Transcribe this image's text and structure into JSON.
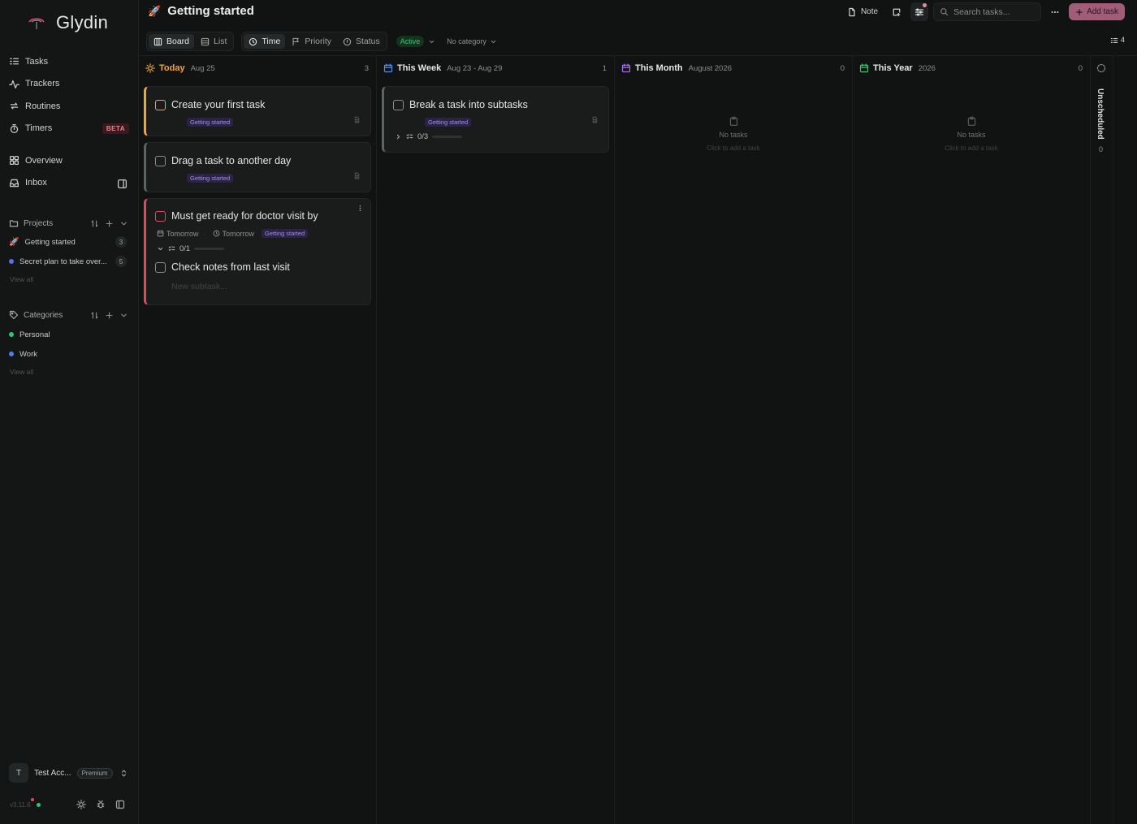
{
  "app": {
    "name": "Glydin",
    "version": "v3.11.6"
  },
  "sidebar": {
    "nav": [
      {
        "label": "Tasks",
        "icon": "tasks-icon"
      },
      {
        "label": "Trackers",
        "icon": "activity-icon"
      },
      {
        "label": "Routines",
        "icon": "repeat-icon"
      },
      {
        "label": "Timers",
        "icon": "timer-icon",
        "badge": "BETA"
      },
      {
        "label": "Overview",
        "icon": "grid-icon"
      },
      {
        "label": "Inbox",
        "icon": "inbox-icon"
      }
    ],
    "projects": {
      "heading": "Projects",
      "items": [
        {
          "label": "Getting started",
          "count": "3",
          "icon": "rocket-emoji"
        },
        {
          "label": "Secret plan to take over...",
          "count": "5",
          "color": "#5a6cf0"
        }
      ],
      "view_all": "View all"
    },
    "categories": {
      "heading": "Categories",
      "items": [
        {
          "label": "Personal",
          "color": "#31c46c"
        },
        {
          "label": "Work",
          "color": "#4e7cf5"
        }
      ],
      "view_all": "View all"
    },
    "account": {
      "initial": "T",
      "name": "Test Acc...",
      "plan": "Premium"
    }
  },
  "header": {
    "title": "Getting started",
    "title_icon": "rocket-emoji",
    "note_label": "Note",
    "search_placeholder": "Search tasks...",
    "add_task_label": "Add task"
  },
  "toolbar": {
    "views": [
      "Board",
      "List"
    ],
    "groupings": [
      "Time",
      "Priority",
      "Status"
    ],
    "status_filter": "Active",
    "category_filter": "No category",
    "task_count": "4"
  },
  "board": {
    "columns": [
      {
        "title": "Today",
        "subtitle": "Aug 25",
        "count": "3",
        "icon": "sun-icon",
        "accent": "#f0a43a"
      },
      {
        "title": "This Week",
        "subtitle": "Aug 23 - Aug 29",
        "count": "1",
        "icon": "calendar-icon",
        "accent": "#4e8cf5"
      },
      {
        "title": "This Month",
        "subtitle": "August 2026",
        "count": "0",
        "icon": "calendar-icon",
        "accent": "#a66cf0",
        "empty_title": "No tasks",
        "empty_hint": "Click to add a task"
      },
      {
        "title": "This Year",
        "subtitle": "2026",
        "count": "0",
        "icon": "calendar-icon",
        "accent": "#31c46c",
        "empty_title": "No tasks",
        "empty_hint": "Click to add a task"
      }
    ],
    "unscheduled": {
      "label": "Unscheduled",
      "count": "0"
    },
    "cards": {
      "c1": {
        "title": "Create your first task",
        "tag": "Getting started",
        "accent": "#f0a43a"
      },
      "c2": {
        "title": "Drag a task to another day",
        "tag": "Getting started",
        "accent": "#5d6362"
      },
      "c3": {
        "title": "Must get ready for doctor visit by",
        "date": "Tomorrow",
        "time": "Tomorrow",
        "tag": "Getting started",
        "progress": "0/1",
        "progress_fraction": 0,
        "subtask": "Check notes from last visit",
        "subtask_placeholder": "New subtask...",
        "accent": "#e5485e"
      },
      "c4": {
        "title": "Break a task into subtasks",
        "tag": "Getting started",
        "progress": "0/3",
        "progress_fraction": 0,
        "accent": "#5d6362"
      }
    }
  }
}
